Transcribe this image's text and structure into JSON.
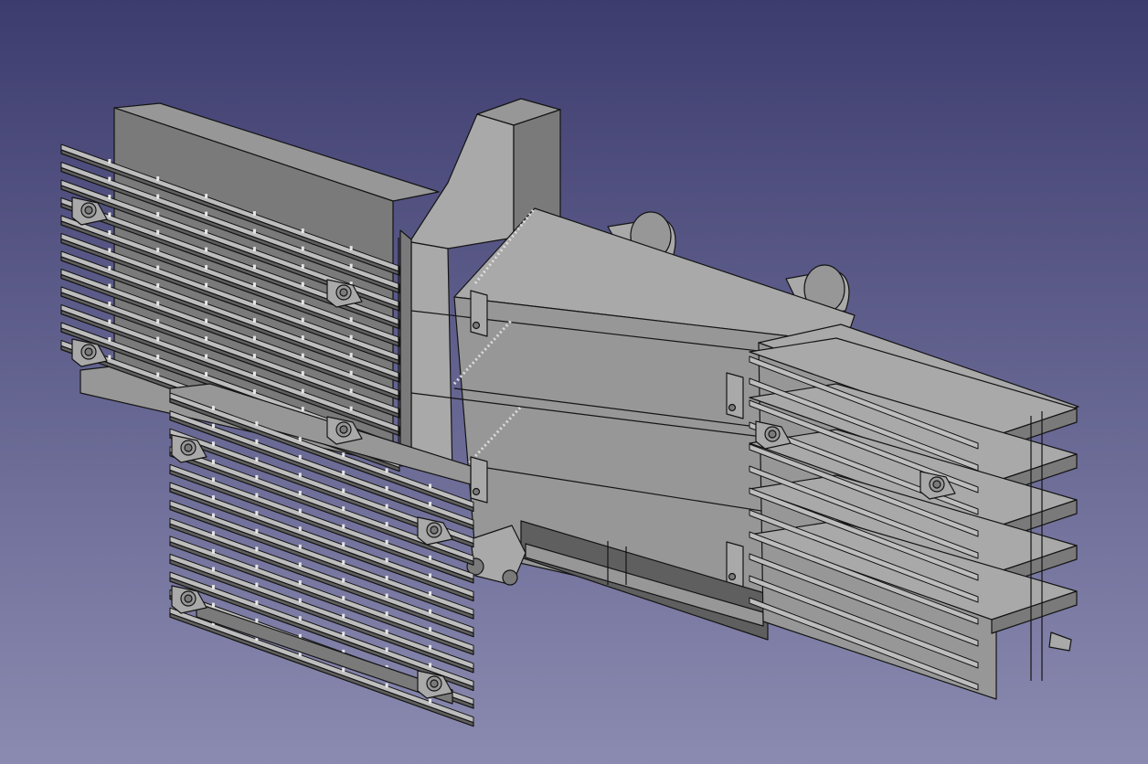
{
  "viewport": {
    "background_top": "#3d3c6f",
    "background_bottom": "#8b8bb1"
  },
  "model": {
    "colors": {
      "face_light": "#a9a9a9",
      "face_mid": "#979797",
      "face_dark": "#7a7a7a",
      "face_shadow": "#5f5f5f",
      "edge": "#141414",
      "fin_top": "#bdbdbd"
    },
    "parts": [
      {
        "name": "left-upper-fin-grid",
        "fin_count": 12
      },
      {
        "name": "left-lower-fin-grid",
        "fin_count": 13
      },
      {
        "name": "central-housing"
      },
      {
        "name": "top-tower"
      },
      {
        "name": "rear-cylinders",
        "count": 2
      },
      {
        "name": "right-fin-stack",
        "fin_count": 5
      },
      {
        "name": "bottom-rail"
      },
      {
        "name": "mounting-bolts",
        "count": 10
      },
      {
        "name": "side-brackets",
        "count": 4
      }
    ]
  }
}
